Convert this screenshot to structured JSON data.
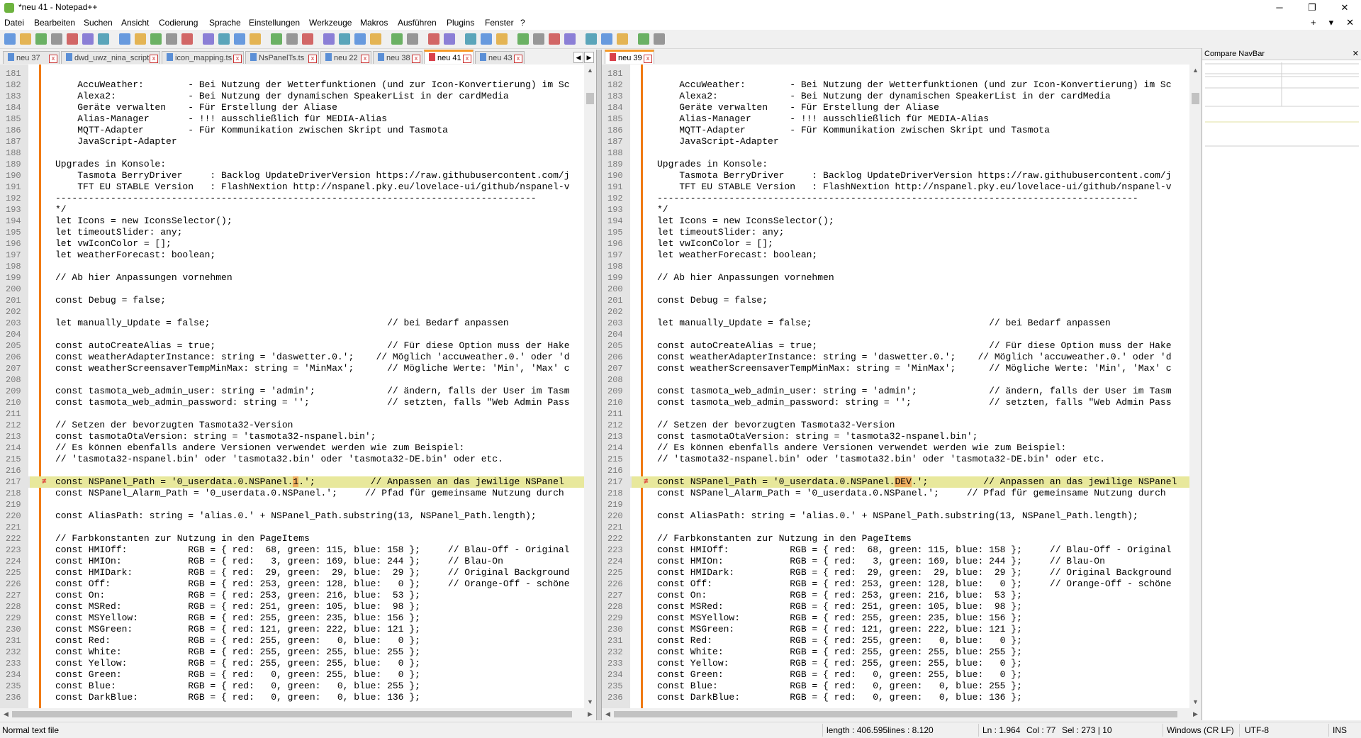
{
  "window": {
    "title": "*neu 41 - Notepad++",
    "minimize": "─",
    "maximize": "❐",
    "close": "✕"
  },
  "menu": [
    "Datei",
    "Bearbeiten",
    "Suchen",
    "Ansicht",
    "Codierung",
    "Sprache",
    "Einstellungen",
    "Werkzeuge",
    "Makros",
    "Ausführen",
    "Plugins",
    "Fenster",
    "?"
  ],
  "menu_right": {
    "add": "+",
    "down": "▾",
    "close": "✕"
  },
  "toolbar_icons": [
    "new-file-icon",
    "open-file-icon",
    "save-icon",
    "save-all-icon",
    "close-icon",
    "close-all-icon",
    "print-icon",
    "cut-icon",
    "copy-icon",
    "paste-icon",
    "undo-icon",
    "redo-icon",
    "find-icon",
    "replace-icon",
    "zoom-in-icon",
    "zoom-out-icon",
    "sync-vertical-icon",
    "sync-horizontal-icon",
    "word-wrap-icon",
    "show-all-chars-icon",
    "indent-guide-icon",
    "doc-map-icon",
    "function-list-icon",
    "folder-workspace-icon",
    "monitoring-icon",
    "record-macro-icon",
    "stop-macro-icon",
    "play-macro-icon",
    "run-macro-icon",
    "save-macro-icon",
    "compare-icon",
    "compare-clear-icon",
    "compare-first-icon",
    "compare-prev-icon",
    "compare-next-icon",
    "compare-last-icon",
    "compare-diff-icon",
    "spell-check-icon",
    "plugin-icon"
  ],
  "left_tabs": [
    {
      "label": "neu 37",
      "active": false
    },
    {
      "label": "dwd_uwz_nina_script.js",
      "active": false
    },
    {
      "label": "icon_mapping.ts",
      "active": false
    },
    {
      "label": "NsPanelTs.ts",
      "active": false
    },
    {
      "label": "neu 22",
      "active": false
    },
    {
      "label": "neu 38",
      "active": false
    },
    {
      "label": "neu 41",
      "active": true
    },
    {
      "label": "neu 43",
      "active": false
    }
  ],
  "right_tabs": [
    {
      "label": "neu 39",
      "active": true
    }
  ],
  "compare_navbar": {
    "title": "Compare NavBar",
    "close": "✕"
  },
  "left_lines": [
    {
      "n": "181",
      "t": ""
    },
    {
      "n": "182",
      "t": "    AccuWeather:        - Bei Nutzung der Wetterfunktionen (und zur Icon-Konvertierung) im Sc"
    },
    {
      "n": "183",
      "t": "    Alexa2:             - Bei Nutzung der dynamischen SpeakerList in der cardMedia"
    },
    {
      "n": "184",
      "t": "    Geräte verwalten    - Für Erstellung der Aliase"
    },
    {
      "n": "185",
      "t": "    Alias-Manager       - !!! ausschließlich für MEDIA-Alias"
    },
    {
      "n": "186",
      "t": "    MQTT-Adapter        - Für Kommunikation zwischen Skript und Tasmota"
    },
    {
      "n": "187",
      "t": "    JavaScript-Adapter"
    },
    {
      "n": "188",
      "t": ""
    },
    {
      "n": "189",
      "t": "Upgrades in Konsole:"
    },
    {
      "n": "190",
      "t": "    Tasmota BerryDriver     : Backlog UpdateDriverVersion https://raw.githubusercontent.com/j"
    },
    {
      "n": "191",
      "t": "    TFT EU STABLE Version   : FlashNextion http://nspanel.pky.eu/lovelace-ui/github/nspanel-v"
    },
    {
      "n": "192",
      "t": "---------------------------------------------------------------------------------------"
    },
    {
      "n": "193",
      "t": "*/"
    },
    {
      "n": "194",
      "t": "let Icons = new IconsSelector();"
    },
    {
      "n": "195",
      "t": "let timeoutSlider: any;"
    },
    {
      "n": "196",
      "t": "let vwIconColor = [];"
    },
    {
      "n": "197",
      "t": "let weatherForecast: boolean;"
    },
    {
      "n": "198",
      "t": ""
    },
    {
      "n": "199",
      "t": "// Ab hier Anpassungen vornehmen"
    },
    {
      "n": "200",
      "t": ""
    },
    {
      "n": "201",
      "t": "const Debug = false;"
    },
    {
      "n": "202",
      "t": ""
    },
    {
      "n": "203",
      "t": "let manually_Update = false;                                // bei Bedarf anpassen"
    },
    {
      "n": "204",
      "t": ""
    },
    {
      "n": "205",
      "t": "const autoCreateAlias = true;                               // Für diese Option muss der Hake"
    },
    {
      "n": "206",
      "t": "const weatherAdapterInstance: string = 'daswetter.0.';    // Möglich 'accuweather.0.' oder 'd"
    },
    {
      "n": "207",
      "t": "const weatherScreensaverTempMinMax: string = 'MinMax';      // Mögliche Werte: 'Min', 'Max' c"
    },
    {
      "n": "208",
      "t": ""
    },
    {
      "n": "209",
      "t": "const tasmota_web_admin_user: string = 'admin';             // ändern, falls der User im Tasm"
    },
    {
      "n": "210",
      "t": "const tasmota_web_admin_password: string = '';              // setzten, falls \"Web Admin Pass"
    },
    {
      "n": "211",
      "t": ""
    },
    {
      "n": "212",
      "t": "// Setzen der bevorzugten Tasmota32-Version"
    },
    {
      "n": "213",
      "t": "const tasmotaOtaVersion: string = 'tasmota32-nspanel.bin';"
    },
    {
      "n": "214",
      "t": "// Es können ebenfalls andere Versionen verwendet werden wie zum Beispiel:"
    },
    {
      "n": "215",
      "t": "// 'tasmota32-nspanel.bin' oder 'tasmota32.bin' oder 'tasmota32-DE.bin' oder etc."
    },
    {
      "n": "216",
      "t": ""
    },
    {
      "n": "217",
      "pre": "const NSPanel_Path = '0_userdata.0.NSPanel.",
      "diff": "1",
      "post": ".';          // Anpassen an das jewilige NSPanel",
      "hl": true
    },
    {
      "n": "218",
      "t": "const NSPanel_Alarm_Path = '0_userdata.0.NSPanel.';     // Pfad für gemeinsame Nutzung durch"
    },
    {
      "n": "219",
      "t": ""
    },
    {
      "n": "220",
      "t": "const AliasPath: string = 'alias.0.' + NSPanel_Path.substring(13, NSPanel_Path.length);"
    },
    {
      "n": "221",
      "t": ""
    },
    {
      "n": "222",
      "t": "// Farbkonstanten zur Nutzung in den PageItems"
    },
    {
      "n": "223",
      "t": "const HMIOff:           RGB = { red:  68, green: 115, blue: 158 };     // Blau-Off - Original"
    },
    {
      "n": "224",
      "t": "const HMIOn:            RGB = { red:   3, green: 169, blue: 244 };     // Blau-On"
    },
    {
      "n": "225",
      "t": "const HMIDark:          RGB = { red:  29, green:  29, blue:  29 };     // Original Background"
    },
    {
      "n": "226",
      "t": "const Off:              RGB = { red: 253, green: 128, blue:   0 };     // Orange-Off - schöne"
    },
    {
      "n": "227",
      "t": "const On:               RGB = { red: 253, green: 216, blue:  53 };"
    },
    {
      "n": "228",
      "t": "const MSRed:            RGB = { red: 251, green: 105, blue:  98 };"
    },
    {
      "n": "229",
      "t": "const MSYellow:         RGB = { red: 255, green: 235, blue: 156 };"
    },
    {
      "n": "230",
      "t": "const MSGreen:          RGB = { red: 121, green: 222, blue: 121 };"
    },
    {
      "n": "231",
      "t": "const Red:              RGB = { red: 255, green:   0, blue:   0 };"
    },
    {
      "n": "232",
      "t": "const White:            RGB = { red: 255, green: 255, blue: 255 };"
    },
    {
      "n": "233",
      "t": "const Yellow:           RGB = { red: 255, green: 255, blue:   0 };"
    },
    {
      "n": "234",
      "t": "const Green:            RGB = { red:   0, green: 255, blue:   0 };"
    },
    {
      "n": "235",
      "t": "const Blue:             RGB = { red:   0, green:   0, blue: 255 };"
    },
    {
      "n": "236",
      "t": "const DarkBlue:         RGB = { red:   0, green:   0, blue: 136 };"
    }
  ],
  "right_diff": {
    "pre": "const NSPanel_Path = '0_userdata.0.NSPanel.",
    "diff": "DEV",
    "post": ".';          // Anpassen an das jewilige NSPanel"
  },
  "status": {
    "type": "Normal text file",
    "length": "length : 406.595",
    "lines": "lines : 8.120",
    "ln": "Ln : 1.964",
    "col": "Col : 77",
    "sel": "Sel : 273 | 10",
    "eol": "Windows (CR LF)",
    "enc": "UTF-8",
    "mode": "INS"
  },
  "colors": {
    "change_bar": "#f07b14",
    "highlight": "#e8e89c",
    "diff_char": "#f0b060",
    "active_tab_top": "#f79a28"
  }
}
